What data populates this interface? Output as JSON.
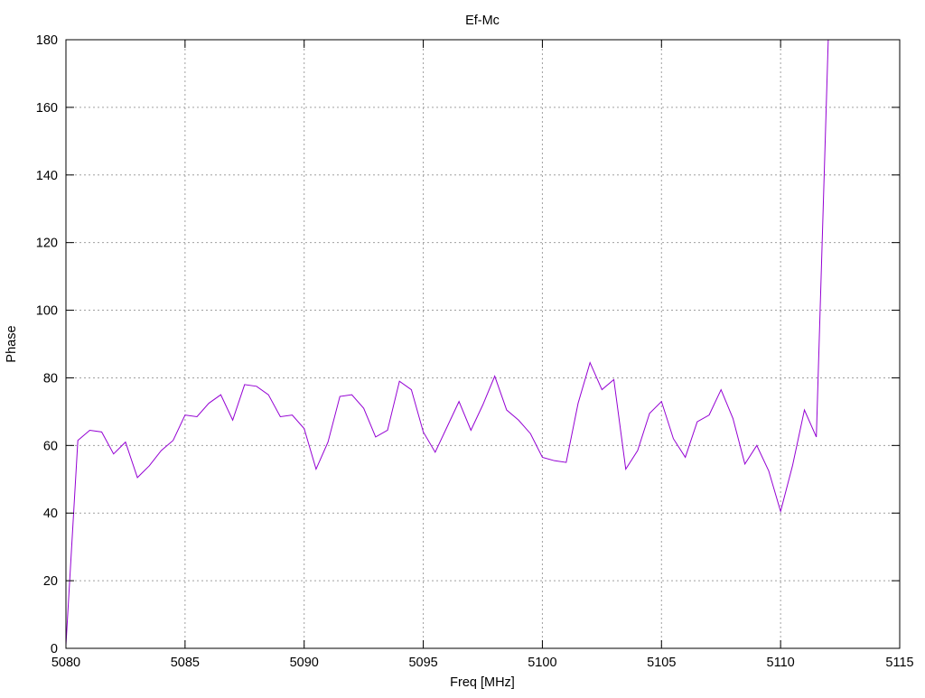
{
  "chart_data": {
    "type": "line",
    "title": "Ef-Mc",
    "xlabel": "Freq [MHz]",
    "ylabel": "Phase",
    "xlim": [
      5080,
      5115
    ],
    "ylim": [
      0,
      180
    ],
    "xticks": [
      5080,
      5085,
      5090,
      5095,
      5100,
      5105,
      5110,
      5115
    ],
    "yticks": [
      0,
      20,
      40,
      60,
      80,
      100,
      120,
      140,
      160,
      180
    ],
    "grid": true,
    "legend": "none",
    "series": [
      {
        "color": "#9400d3",
        "x": [
          5080,
          5080.5,
          5081,
          5081.5,
          5082,
          5082.5,
          5083,
          5083.5,
          5084,
          5084.5,
          5085,
          5085.5,
          5086,
          5086.5,
          5087,
          5087.5,
          5088,
          5088.5,
          5089,
          5089.5,
          5090,
          5090.5,
          5091,
          5091.5,
          5092,
          5092.5,
          5093,
          5093.5,
          5094,
          5094.5,
          5095,
          5095.5,
          5096,
          5096.5,
          5097,
          5097.5,
          5098,
          5098.5,
          5099,
          5099.5,
          5100,
          5100.5,
          5101,
          5101.5,
          5102,
          5102.5,
          5103,
          5103.5,
          5104,
          5104.5,
          5105,
          5105.5,
          5106,
          5106.5,
          5107,
          5107.5,
          5108,
          5108.5,
          5109,
          5109.5,
          5110,
          5110.5,
          5111,
          5111.5,
          5112
        ],
        "y": [
          1,
          61.5,
          64.5,
          64,
          57.5,
          61,
          50.5,
          54,
          58.5,
          61.5,
          69,
          68.5,
          72.5,
          75,
          67.5,
          78,
          77.5,
          75,
          68.5,
          69,
          65,
          53,
          61,
          74.5,
          75,
          71,
          62.5,
          64.5,
          79,
          76.5,
          64,
          58,
          65.5,
          73,
          64.5,
          72,
          80.5,
          70.5,
          67.5,
          63.5,
          56.5,
          55.5,
          55,
          72.5,
          84.5,
          76.5,
          79.5,
          53,
          58.5,
          69.5,
          73,
          62,
          56.5,
          67,
          69,
          76.5,
          68,
          54.5,
          60,
          52.5,
          40.5,
          54,
          70.5,
          62.5,
          180
        ]
      }
    ]
  }
}
